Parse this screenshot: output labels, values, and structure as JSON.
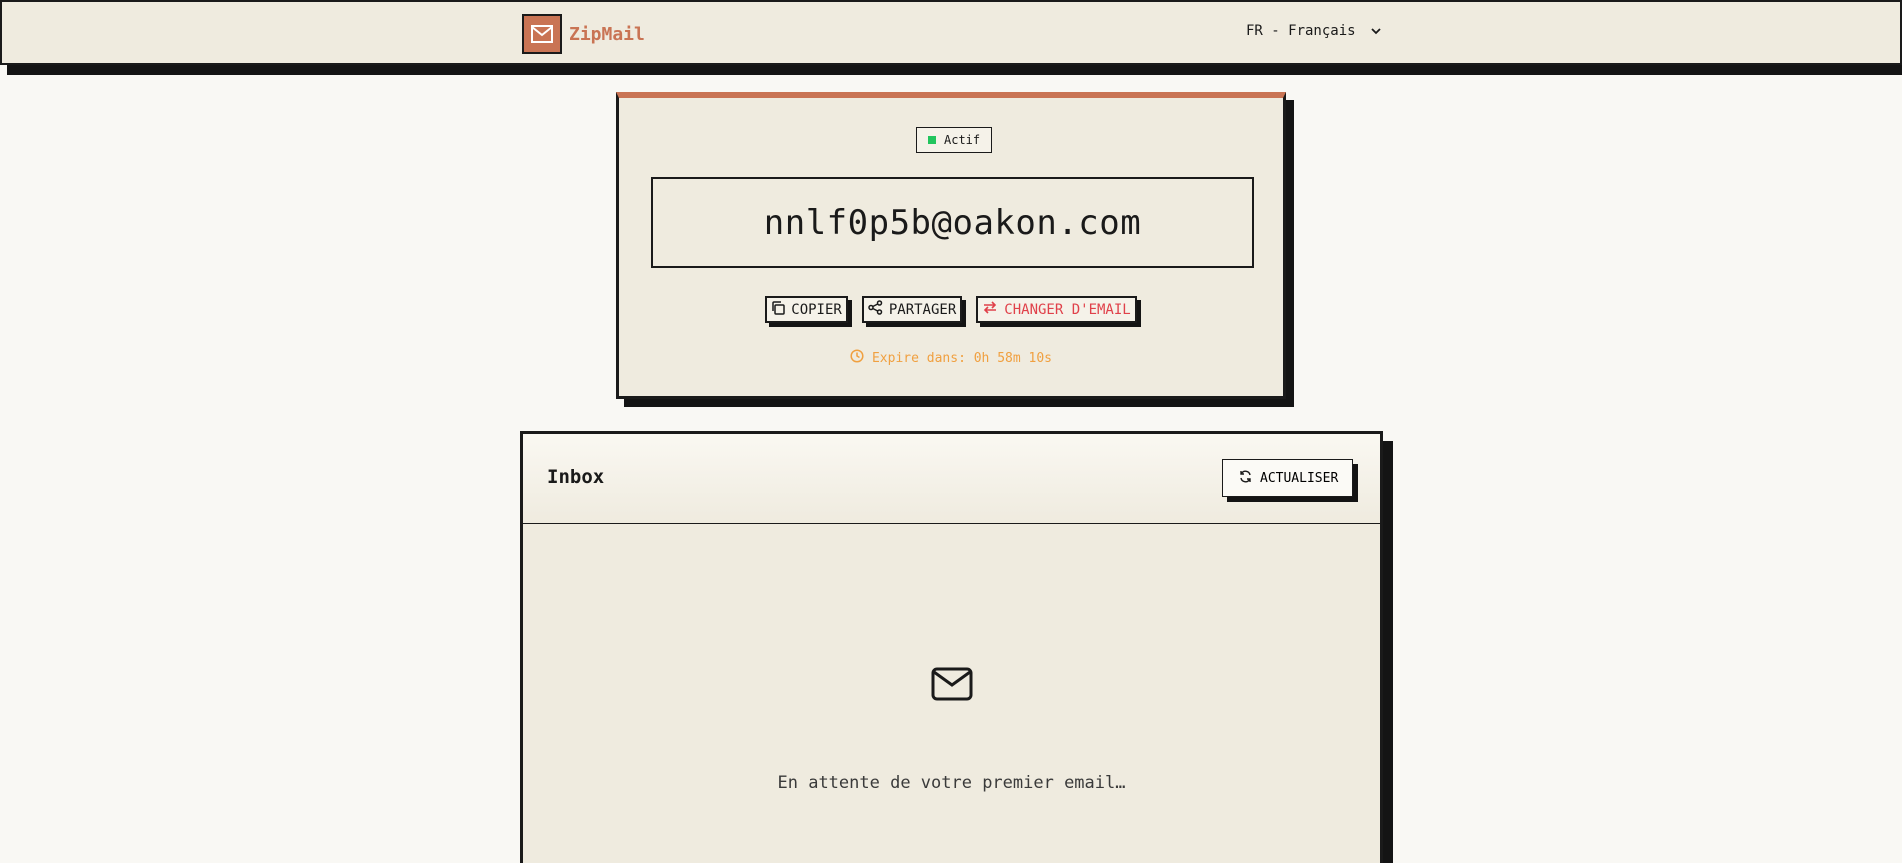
{
  "header": {
    "brand": "ZipMail",
    "language": "FR - Français"
  },
  "email": {
    "status": "Actif",
    "address": "nnlf0p5b@oakon.com",
    "expire": "Expire dans: 0h 58m 10s",
    "actions": {
      "copy": "COPIER",
      "share": "PARTAGER",
      "change": "CHANGER D'EMAIL"
    }
  },
  "inbox": {
    "title": "Inbox",
    "refresh": "ACTUALISER",
    "empty": "En attente de votre premier email…"
  },
  "colors": {
    "accent": "#c97454",
    "danger": "#e0414a",
    "warning": "#f0a040",
    "active": "#22c55e"
  }
}
